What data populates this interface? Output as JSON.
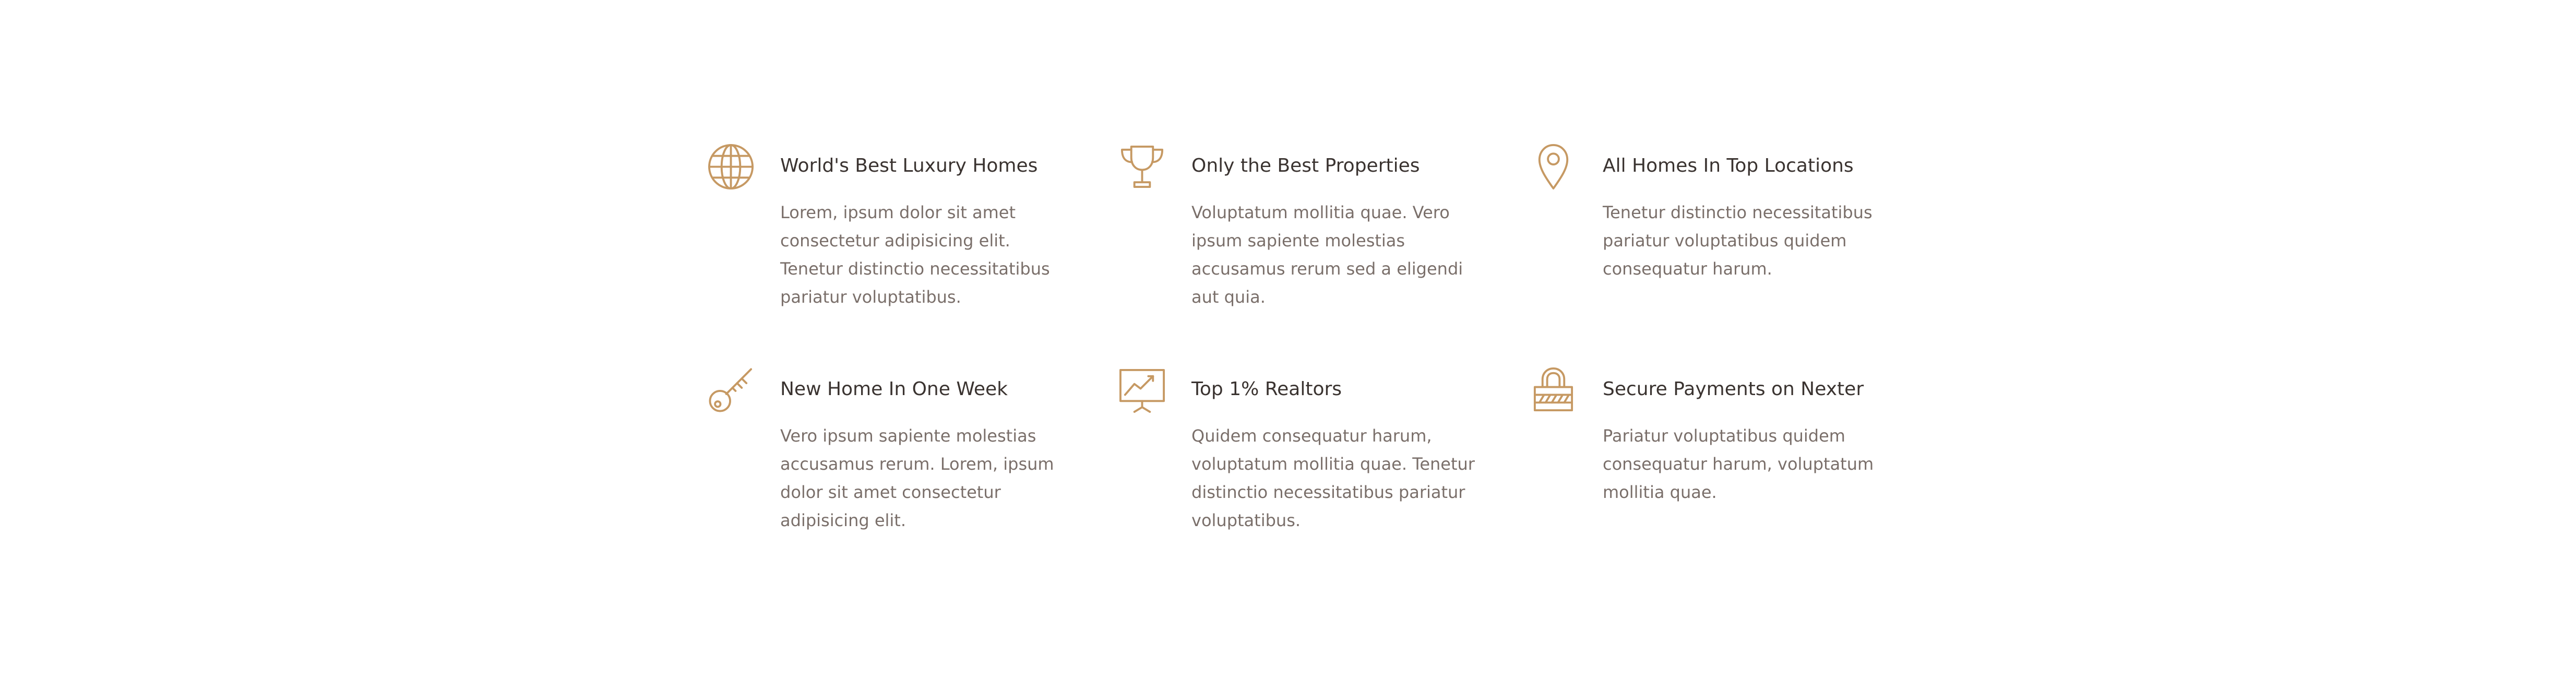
{
  "accent_color": "#c69963",
  "features": [
    {
      "icon": "globe-icon",
      "title": "World's Best Luxury Homes",
      "text": "Lorem, ipsum dolor sit amet consectetur adipisicing elit. Tenetur distinctio necessitatibus pariatur voluptatibus."
    },
    {
      "icon": "trophy-icon",
      "title": "Only the Best Properties",
      "text": "Voluptatum mollitia quae. Vero ipsum sapiente molestias accusamus rerum sed a eligendi aut quia."
    },
    {
      "icon": "map-pin-icon",
      "title": "All Homes In Top Locations",
      "text": "Tenetur distinctio necessitatibus pariatur voluptatibus quidem consequatur harum."
    },
    {
      "icon": "key-icon",
      "title": "New Home In One Week",
      "text": "Vero ipsum sapiente molestias accusamus rerum. Lorem, ipsum dolor sit amet consectetur adipisicing elit."
    },
    {
      "icon": "presentation-chart-icon",
      "title": "Top 1% Realtors",
      "text": "Quidem consequatur harum, voluptatum mollitia quae. Tenetur distinctio necessitatibus pariatur voluptatibus."
    },
    {
      "icon": "lock-icon",
      "title": "Secure Payments on Nexter",
      "text": "Pariatur voluptatibus quidem consequatur harum, voluptatum mollitia quae."
    }
  ]
}
